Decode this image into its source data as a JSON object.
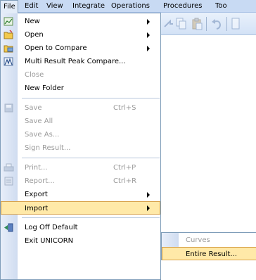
{
  "menubar": {
    "items": [
      {
        "label": "File"
      },
      {
        "label": "Edit"
      },
      {
        "label": "View"
      },
      {
        "label": "Integrate"
      },
      {
        "label": "Operations"
      },
      {
        "label": "Procedures"
      },
      {
        "label": "Too"
      }
    ]
  },
  "file_menu": {
    "items": [
      {
        "label": "New",
        "icon": "new-icon",
        "submenu": true
      },
      {
        "label": "Open",
        "icon": "open-folder-icon",
        "submenu": true
      },
      {
        "label": "Open to Compare",
        "icon": "open-compare-icon",
        "submenu": true
      },
      {
        "label": "Multi Result Peak Compare...",
        "icon": "peak-compare-icon"
      },
      {
        "label": "Close",
        "disabled": true
      },
      {
        "label": "New Folder"
      },
      {
        "label": "Save",
        "shortcut": "Ctrl+S",
        "disabled": true,
        "icon": "save-icon"
      },
      {
        "label": "Save All",
        "disabled": true
      },
      {
        "label": "Save As...",
        "disabled": true
      },
      {
        "label": "Sign Result...",
        "disabled": true
      },
      {
        "label": "Print...",
        "shortcut": "Ctrl+P",
        "disabled": true,
        "icon": "print-icon"
      },
      {
        "label": "Report...",
        "shortcut": "Ctrl+R",
        "disabled": true,
        "icon": "report-icon"
      },
      {
        "label": "Export",
        "submenu": true
      },
      {
        "label": "Import",
        "submenu": true,
        "highlighted": true
      },
      {
        "label": "Log Off Default",
        "icon": "log-off-icon"
      },
      {
        "label": "Exit UNICORN"
      }
    ]
  },
  "import_submenu": {
    "items": [
      {
        "label": "Curves",
        "disabled": true
      },
      {
        "label": "Entire Result...",
        "highlighted": true
      }
    ]
  },
  "colors": {
    "menubar_bg": "#c8daf3",
    "highlight_bg": "#ffe9a8",
    "highlight_border": "#d8a24a",
    "disabled_text": "#9a9a9a"
  }
}
